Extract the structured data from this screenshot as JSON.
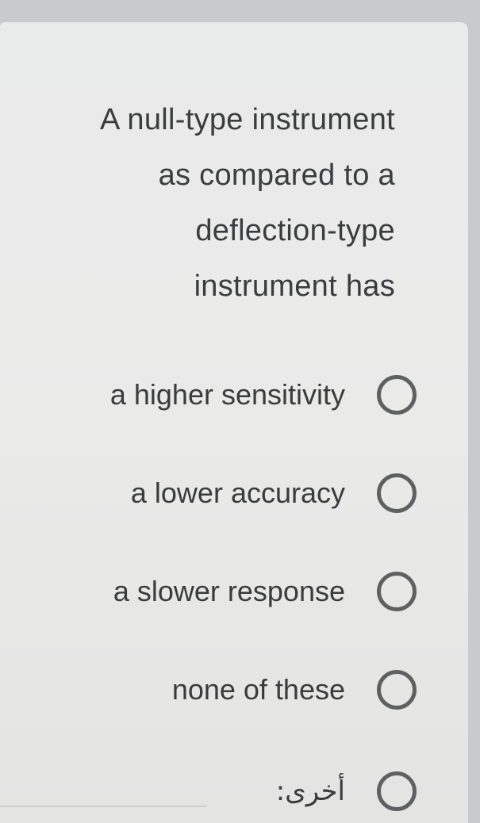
{
  "question": {
    "lines": [
      "A null-type instrument",
      "as compared to a",
      "deflection-type",
      "instrument has"
    ]
  },
  "options": [
    {
      "label": "a higher sensitivity",
      "selected": false
    },
    {
      "label": "a lower accuracy",
      "selected": false
    },
    {
      "label": "a slower response",
      "selected": false
    },
    {
      "label": "none of these",
      "selected": false
    },
    {
      "label": "أخرى:",
      "selected": false
    }
  ],
  "colors": {
    "background": "#c9cacb",
    "card": "#eaeaea",
    "text": "#3b3c3d",
    "radio_border": "#5f6061"
  }
}
